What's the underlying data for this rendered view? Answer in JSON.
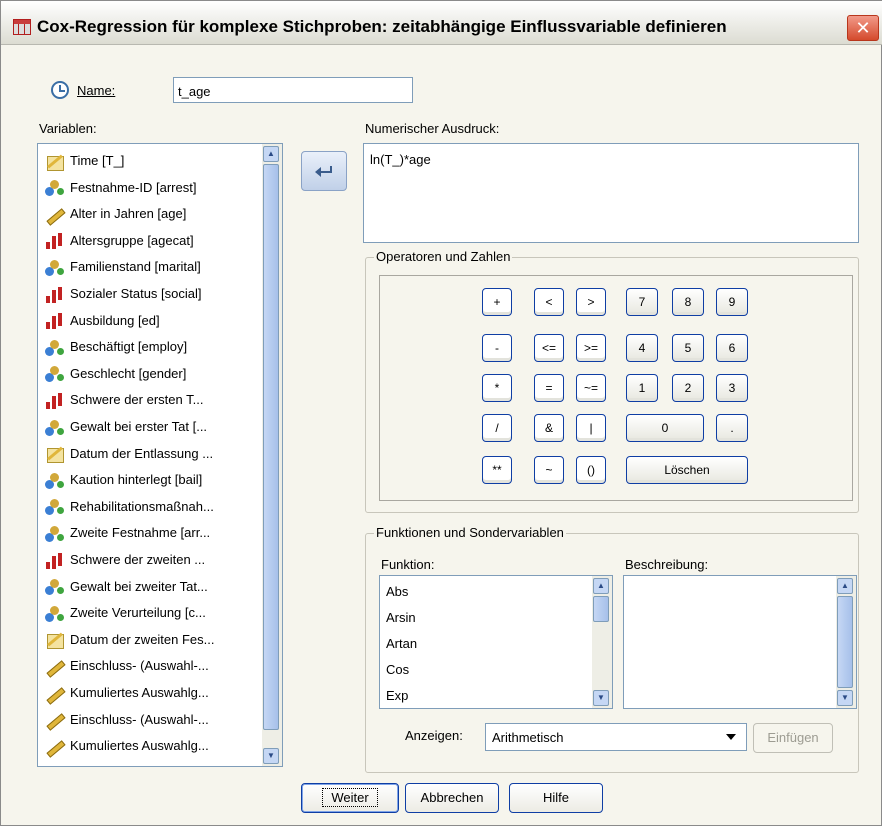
{
  "window": {
    "title": "Cox-Regression für komplexe Stichproben: zeitabhängige Einflussvariable definieren",
    "close_glyph": "✕"
  },
  "name_field": {
    "label": "Name:",
    "value": "t_age"
  },
  "variables": {
    "label": "Variablen:",
    "items": [
      {
        "label": "Time [T_]",
        "icon": "date-scale-icon"
      },
      {
        "label": "Festnahme-ID [arrest]",
        "icon": "nominal-icon"
      },
      {
        "label": "Alter in Jahren [age]",
        "icon": "scale-icon"
      },
      {
        "label": "Altersgruppe [agecat]",
        "icon": "ordinal-icon"
      },
      {
        "label": "Familienstand [marital]",
        "icon": "nominal-icon"
      },
      {
        "label": "Sozialer Status [social]",
        "icon": "ordinal-icon"
      },
      {
        "label": "Ausbildung [ed]",
        "icon": "ordinal-icon"
      },
      {
        "label": "Beschäftigt [employ]",
        "icon": "nominal-icon"
      },
      {
        "label": "Geschlecht [gender]",
        "icon": "nominal-icon"
      },
      {
        "label": "Schwere der ersten T...",
        "icon": "ordinal-icon"
      },
      {
        "label": "Gewalt bei erster Tat [...",
        "icon": "nominal-icon"
      },
      {
        "label": "Datum der Entlassung ...",
        "icon": "date-scale-icon"
      },
      {
        "label": "Kaution hinterlegt [bail]",
        "icon": "nominal-icon"
      },
      {
        "label": "Rehabilitationsmaßnah...",
        "icon": "nominal-icon"
      },
      {
        "label": "Zweite Festnahme [arr...",
        "icon": "nominal-icon"
      },
      {
        "label": "Schwere der zweiten ...",
        "icon": "ordinal-icon"
      },
      {
        "label": "Gewalt bei zweiter Tat...",
        "icon": "nominal-icon"
      },
      {
        "label": "Zweite Verurteilung [c...",
        "icon": "nominal-icon"
      },
      {
        "label": "Datum der zweiten Fes...",
        "icon": "date-scale-icon"
      },
      {
        "label": "Einschluss- (Auswahl-...",
        "icon": "scale-icon"
      },
      {
        "label": "Kumuliertes Auswahlg...",
        "icon": "scale-icon"
      },
      {
        "label": "Einschluss- (Auswahl-...",
        "icon": "scale-icon"
      },
      {
        "label": "Kumuliertes Auswahlg...",
        "icon": "scale-icon"
      }
    ]
  },
  "expression": {
    "label": "Numerischer Ausdruck:",
    "value": "ln(T_)*age"
  },
  "operators": {
    "title": "Operatoren und Zahlen",
    "keys": {
      "plus": "+",
      "lt": "<",
      "gt": ">",
      "seven": "7",
      "eight": "8",
      "nine": "9",
      "minus": "-",
      "le": "<=",
      "ge": ">=",
      "four": "4",
      "five": "5",
      "six": "6",
      "mult": "*",
      "eq": "=",
      "ne": "~=",
      "one": "1",
      "two": "2",
      "three": "3",
      "div": "/",
      "and": "&",
      "or": "|",
      "zero": "0",
      "dot": ".",
      "pow": "**",
      "not": "~",
      "paren": "()",
      "delete": "Löschen"
    }
  },
  "functions": {
    "title": "Funktionen und Sondervariablen",
    "function_label": "Funktion:",
    "description_label": "Beschreibung:",
    "items": [
      "Abs",
      "Arsin",
      "Artan",
      "Cos",
      "Exp"
    ],
    "show_label": "Anzeigen:",
    "show_value": "Arithmetisch",
    "insert_button": "Einfügen"
  },
  "buttons": {
    "continue": "Weiter",
    "cancel": "Abbrechen",
    "help": "Hilfe"
  }
}
